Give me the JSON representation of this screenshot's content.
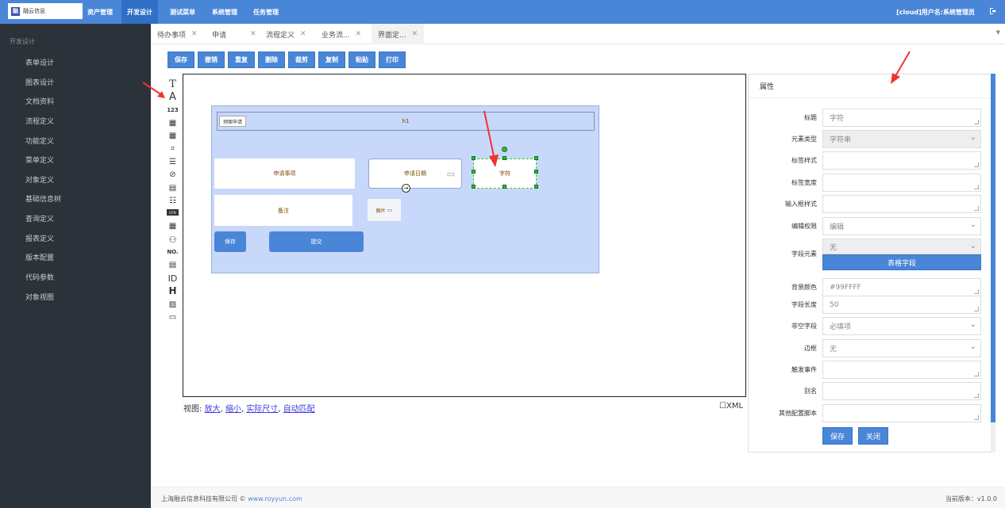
{
  "topbar": {
    "logo_text": "融云信息",
    "nav": [
      "资产管理",
      "开发设计",
      "测试菜单",
      "系统管理",
      "任务管理"
    ],
    "active_nav": "开发设计",
    "user_text": "[cloud]用户名:系统管理员"
  },
  "sidebar": {
    "title": "开发设计",
    "items": [
      "表单设计",
      "图表设计",
      "文档资料",
      "流程定义",
      "功能定义",
      "菜单定义",
      "对象定义",
      "基础信息树",
      "查询定义",
      "报表定义",
      "版本配置",
      "代码参数",
      "对象视图"
    ]
  },
  "tabs": [
    {
      "label": "待办事项"
    },
    {
      "label": "申请"
    },
    {
      "label": "流程定义"
    },
    {
      "label": "业务流..."
    },
    {
      "label": "界面定..."
    }
  ],
  "toolbar": [
    "保存",
    "撤销",
    "重复",
    "删除",
    "裁剪",
    "复制",
    "粘贴",
    "打印"
  ],
  "palette_glyphs": [
    "T",
    "A",
    "123",
    "▦",
    "▦",
    "⌗",
    "☰",
    "⊘",
    "▤",
    "☷",
    "DTN",
    "▦",
    "⚇",
    "NO.",
    "▤",
    "ID",
    "H",
    "▨",
    "▭"
  ],
  "form": {
    "header_tag": "预案申请",
    "header_title": "h1",
    "field_apply": "申请事项",
    "field_date": "申请日期",
    "field_string": "字符",
    "field_remark": "备注",
    "field_image": "图片",
    "btn_save": "保存",
    "btn_submit": "提交"
  },
  "viewbar": {
    "prefix": "视图:",
    "zoom_in": "放大",
    "zoom_out": "缩小",
    "actual": "实际尺寸",
    "fit": "自动匹配",
    "sep": ",",
    "xml": "XML"
  },
  "props": {
    "title": "属性",
    "rows": [
      {
        "label": "标题",
        "value": "字符",
        "type": "ta"
      },
      {
        "label": "元素类型",
        "value": "字符串",
        "type": "sel-gray"
      },
      {
        "label": "标签样式",
        "value": "",
        "type": "ta"
      },
      {
        "label": "标签宽度",
        "value": "",
        "type": "ta"
      },
      {
        "label": "输入框样式",
        "value": "",
        "type": "ta"
      },
      {
        "label": "编辑权限",
        "value": "编辑",
        "type": "sel"
      },
      {
        "label": "字段元素",
        "value": "无",
        "type": "sel-gray"
      },
      {
        "label": "背景颜色",
        "value": "#99FFFF",
        "type": "ta"
      },
      {
        "label": "字段长度",
        "value": "50",
        "type": "ta"
      },
      {
        "label": "非空字段",
        "value": "必填项",
        "type": "sel"
      },
      {
        "label": "边框",
        "value": "无",
        "type": "sel"
      },
      {
        "label": "触发事件",
        "value": "",
        "type": "ta"
      },
      {
        "label": "别名",
        "value": "",
        "type": "ta"
      },
      {
        "label": "其他配置脚本",
        "value": "",
        "type": "ta"
      }
    ],
    "table_field_button": "表格字段",
    "save_button": "保存",
    "close_button": "关闭"
  },
  "footer": {
    "company": "上海融云信息科技有限公司 ©",
    "site": "www.royyun.com",
    "version": "当前版本：v1.0.0"
  },
  "colors": {
    "accent": "#4a86d8",
    "sidebar": "#2c3239",
    "form_bg": "#c8d8fb",
    "arrow": "#ee3333"
  }
}
